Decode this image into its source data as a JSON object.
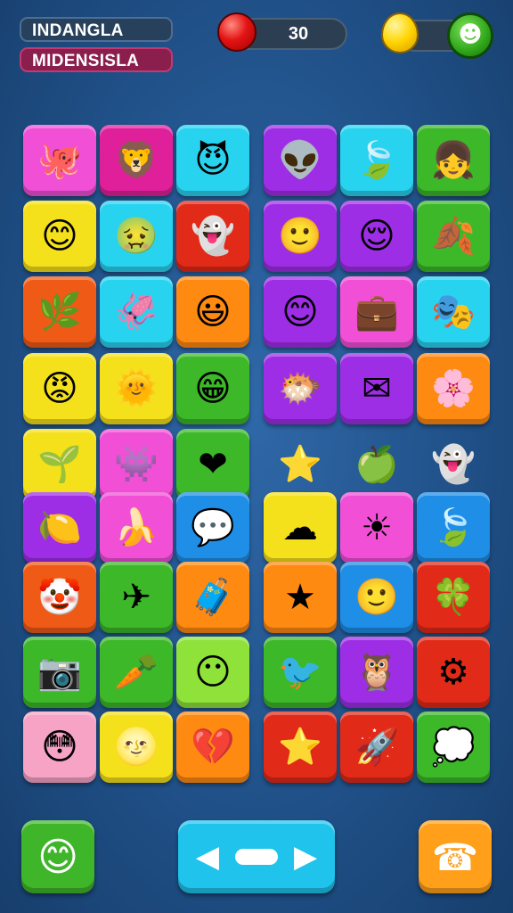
{
  "hud": {
    "label_1": "INDANGLA",
    "label_2": "MIDENSISLA",
    "score": "30",
    "score_ball_color": "#e31414",
    "gem_color": "#ffd400",
    "menu_icon": "skull-icon"
  },
  "board": {
    "rows": [
      [
        {
          "color": "#f04fd6",
          "icon": "octopus-icon",
          "glyph": "🐙"
        },
        {
          "color": "#e0209a",
          "icon": "lion-face-icon",
          "glyph": "🦁"
        },
        {
          "color": "#28d3f0",
          "icon": "purple-devil-icon",
          "glyph": "😈"
        },
        {
          "color": "#9e2ee6",
          "icon": "alien-face-icon",
          "glyph": "👽"
        },
        {
          "color": "#28d3f0",
          "icon": "leaf-icon",
          "glyph": "🍃"
        },
        {
          "color": "#3cb829",
          "icon": "girl-face-icon",
          "glyph": "👧"
        }
      ],
      [
        {
          "color": "#f5e11b",
          "icon": "pink-face-icon",
          "glyph": "😊"
        },
        {
          "color": "#28d3f0",
          "icon": "green-face-icon",
          "glyph": "🤢"
        },
        {
          "color": "#e22a18",
          "icon": "ghost-face-icon",
          "glyph": "👻"
        },
        {
          "color": "#9e2ee6",
          "icon": "yellow-face-icon",
          "glyph": "🙂"
        },
        {
          "color": "#9e2ee6",
          "icon": "yellow-smile-icon",
          "glyph": "😌"
        },
        {
          "color": "#3cb829",
          "icon": "orange-leaf-icon",
          "glyph": "🍂"
        }
      ],
      [
        {
          "color": "#ef5a16",
          "icon": "green-leaf-icon",
          "glyph": "🌿"
        },
        {
          "color": "#28d3f0",
          "icon": "blue-octopus-icon",
          "glyph": "🦑"
        },
        {
          "color": "#ff8a12",
          "icon": "lime-face-icon",
          "glyph": "😃"
        },
        {
          "color": "#9e2ee6",
          "icon": "yellow-smile-icon",
          "glyph": "😊"
        },
        {
          "color": "#f04fd6",
          "icon": "briefcase-icon",
          "glyph": "💼"
        },
        {
          "color": "#28d3f0",
          "icon": "white-mask-icon",
          "glyph": "🎭"
        }
      ],
      [
        {
          "color": "#f5e11b",
          "icon": "red-face-icon",
          "glyph": "😡"
        },
        {
          "color": "#f5e11b",
          "icon": "blue-sun-face-icon",
          "glyph": "🌞"
        },
        {
          "color": "#3cb829",
          "icon": "grin-face-icon",
          "glyph": "😁"
        },
        {
          "color": "#9e2ee6",
          "icon": "purple-squid-icon",
          "glyph": "🐡"
        },
        {
          "color": "#9e2ee6",
          "icon": "envelope-icon",
          "glyph": "✉"
        },
        {
          "color": "#ff8a12",
          "icon": "pink-flower-icon",
          "glyph": "🌸"
        }
      ],
      [
        {
          "color": "#f5e11b",
          "icon": "arrow-leaf-icon",
          "glyph": "🌱"
        },
        {
          "color": "#f04fd6",
          "icon": "blue-monster-icon",
          "glyph": "👾"
        },
        {
          "color": "#3cb829",
          "icon": "heart-icon",
          "glyph": "❤"
        },
        {
          "color": "",
          "icon": "star-icon",
          "glyph": "⭐"
        },
        {
          "color": "",
          "icon": "spiky-fruit-icon",
          "glyph": "🍏"
        },
        {
          "color": "",
          "icon": "ghost-icon",
          "glyph": "👻"
        }
      ],
      [
        {
          "color": "#9e2ee6",
          "icon": "lemon-icon",
          "glyph": "🍋"
        },
        {
          "color": "#f04fd6",
          "icon": "banana-icon",
          "glyph": "🍌"
        },
        {
          "color": "#1f8ee6",
          "icon": "speech-bubble-icon",
          "glyph": "💬"
        },
        {
          "color": "#f5e11b",
          "icon": "blue-cloud-face-icon",
          "glyph": "☁"
        },
        {
          "color": "#f04fd6",
          "icon": "sun-icon",
          "glyph": "☀"
        },
        {
          "color": "#1f8ee6",
          "icon": "green-leaf-icon",
          "glyph": "🍃"
        }
      ],
      [
        {
          "color": "#ef5a16",
          "icon": "clown-face-icon",
          "glyph": "🤡"
        },
        {
          "color": "#3cb829",
          "icon": "paper-plane-icon",
          "glyph": "✈"
        },
        {
          "color": "#ff8a12",
          "icon": "bag-icon",
          "glyph": "🧳"
        },
        {
          "color": "#ff8a12",
          "icon": "blue-star-icon",
          "glyph": "★"
        },
        {
          "color": "#1f8ee6",
          "icon": "yellow-smile-icon",
          "glyph": "🙂"
        },
        {
          "color": "#e22a18",
          "icon": "clover-icon",
          "glyph": "🍀"
        }
      ],
      [
        {
          "color": "#3cb829",
          "icon": "camera-icon",
          "glyph": "📷"
        },
        {
          "color": "#3cb829",
          "icon": "carrot-icon",
          "glyph": "🥕"
        },
        {
          "color": "#8ee23a",
          "icon": "cloud-face-icon",
          "glyph": "😶"
        },
        {
          "color": "#3cb829",
          "icon": "green-bird-icon",
          "glyph": "🐦"
        },
        {
          "color": "#9e2ee6",
          "icon": "owl-face-icon",
          "glyph": "🦉"
        },
        {
          "color": "#e22a18",
          "icon": "purple-gear-icon",
          "glyph": "⚙"
        }
      ],
      [
        {
          "color": "#f7a3c6",
          "icon": "red-face-icon",
          "glyph": "😳"
        },
        {
          "color": "#f5e11b",
          "icon": "orange-sun-face-icon",
          "glyph": "🌝"
        },
        {
          "color": "#ff8a12",
          "icon": "broken-heart-icon",
          "glyph": "💔"
        },
        {
          "color": "#e22a18",
          "icon": "star-icon",
          "glyph": "⭐"
        },
        {
          "color": "#e22a18",
          "icon": "rocket-icon",
          "glyph": "🚀"
        },
        {
          "color": "#3cb829",
          "icon": "blue-bubble-icon",
          "glyph": "💭"
        }
      ]
    ]
  },
  "controls": {
    "left_button_icon": "smiley-icon",
    "left_glyph": "😊",
    "dpad_icon": "dpad-icon",
    "left_arrow": "◀",
    "right_arrow": "▶",
    "right_button_icon": "phone-icon",
    "right_glyph": "☎"
  }
}
